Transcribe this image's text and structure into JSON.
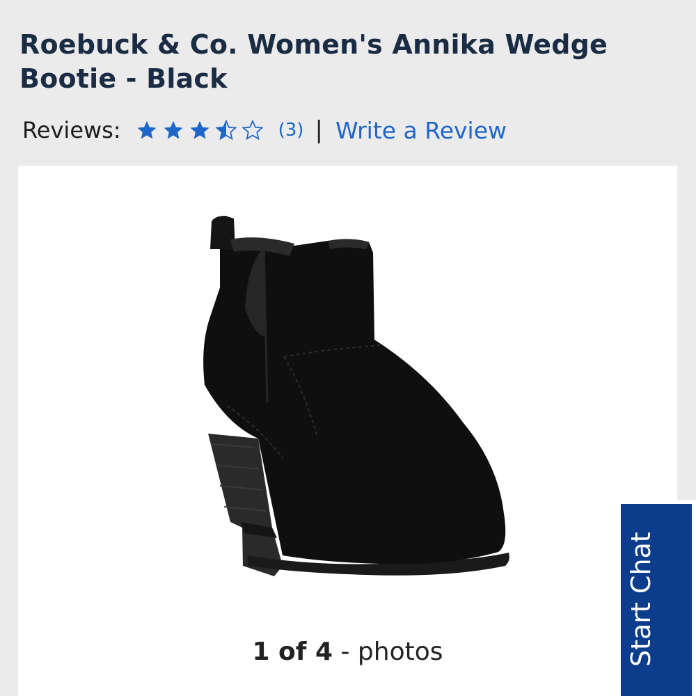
{
  "product": {
    "title": "Roebuck & Co. Women's Annika Wedge Bootie - Black"
  },
  "reviews": {
    "label": "Reviews:",
    "rating": 3.5,
    "max_rating": 5,
    "count_text": "(3)",
    "separator": "|",
    "write_review_label": "Write a Review"
  },
  "gallery": {
    "current": "1 of 4",
    "suffix": "- photos"
  },
  "chat": {
    "label": "Start Chat"
  },
  "colors": {
    "title": "#1a2b44",
    "link": "#1f66c9",
    "star": "#1f66c9",
    "chat_bg": "#0c3c8c",
    "page_bg": "#ecebeb"
  },
  "icons": {
    "star_full": "star-icon",
    "star_half": "star-half-icon",
    "star_empty": "star-empty-icon"
  }
}
